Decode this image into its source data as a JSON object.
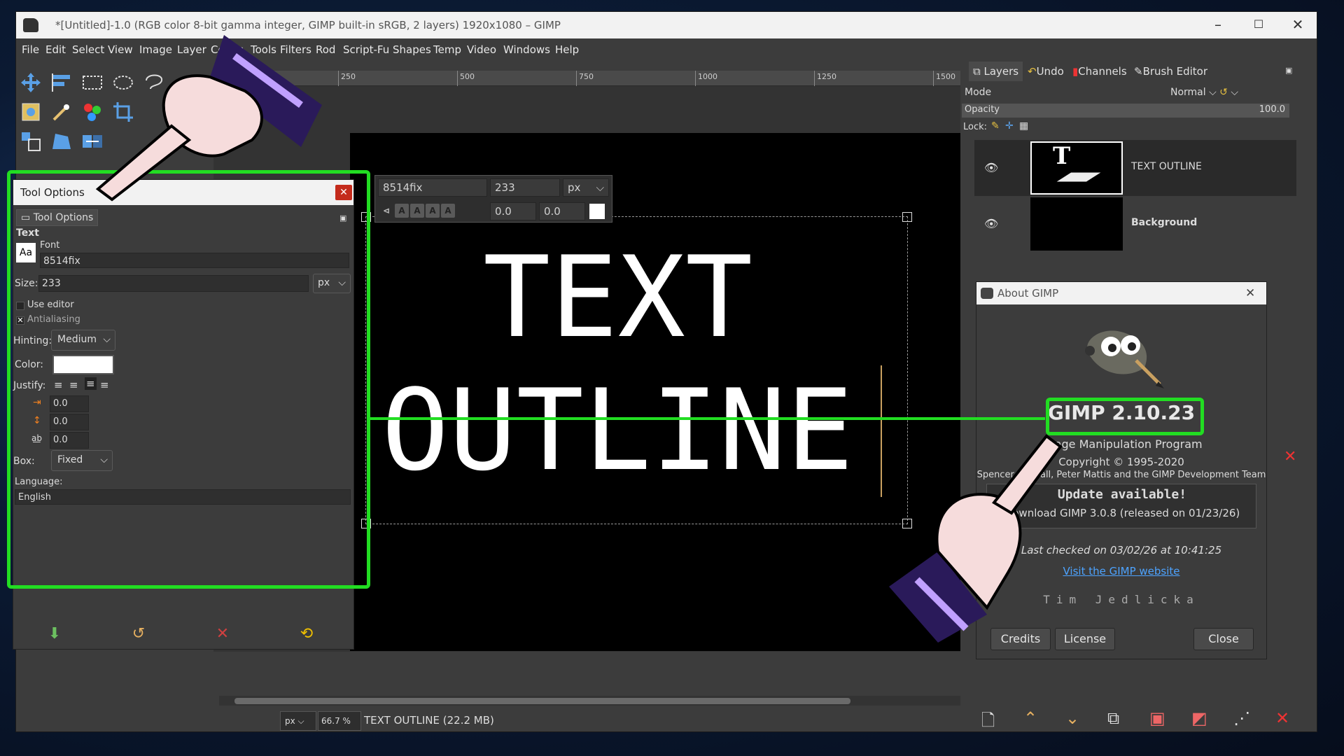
{
  "window": {
    "title": "*[Untitled]-1.0 (RGB color 8-bit gamma integer, GIMP built-in sRGB, 2 layers) 1920x1080 – GIMP",
    "minimize": "–",
    "maximize": "☐",
    "close": "✕"
  },
  "menu": [
    "File",
    "Edit",
    "Select",
    "View",
    "Image",
    "Layer",
    "Colors",
    "Tools",
    "Filters",
    "Rod",
    "Script-Fu",
    "Shapes",
    "Temp",
    "Video",
    "Windows",
    "Help"
  ],
  "ruler": [
    "250",
    "500",
    "750",
    "1000",
    "1250",
    "1500"
  ],
  "text_toolbar": {
    "font": "8514fix",
    "size": "233",
    "unit": "px",
    "baseline": "0.0",
    "kerning": "0.0"
  },
  "canvas": {
    "line1": "TEXT",
    "line2": "OUTLINE"
  },
  "status": {
    "unit": "px",
    "zoom": "66.7 %",
    "info": "TEXT OUTLINE (22.2 MB)"
  },
  "tool_options": {
    "window_title": "Tool Options",
    "tab_label": "Tool Options",
    "section": "Text",
    "font_label": "Font",
    "font_value": "8514fix",
    "font_preview": "Aa",
    "size_label": "Size:",
    "size_value": "233",
    "size_unit": "px",
    "use_editor": "Use editor",
    "antialiasing": "Antialiasing",
    "hinting_label": "Hinting:",
    "hinting_value": "Medium",
    "color_label": "Color:",
    "justify_label": "Justify:",
    "indent": "0.0",
    "line_spacing": "0.0",
    "letter_spacing": "0.0",
    "box_label": "Box:",
    "box_value": "Fixed",
    "language_label": "Language:",
    "language_value": "English"
  },
  "dock": {
    "tabs": [
      "Layers",
      "Undo",
      "Channels",
      "Brush Editor"
    ],
    "mode_label": "Mode",
    "mode_value": "Normal",
    "opacity_label": "Opacity",
    "opacity_value": "100.0",
    "lock_label": "Lock:",
    "layers": [
      {
        "name": "TEXT OUTLINE"
      },
      {
        "name": "Background"
      }
    ]
  },
  "about": {
    "title": "About GIMP",
    "version": "GIMP 2.10.23",
    "subtitle": "Image Manipulation Program",
    "copyright": "Copyright © 1995-2020",
    "authors": "Spencer Kimball, Peter Mattis and the GIMP Development Team",
    "update_heading": "Update available!",
    "update_text": "Download GIMP 3.0.8 (released on 01/23/26)",
    "checked_text": "Last checked on 03/02/26 at 10:41:25",
    "link": "Visit the GIMP website",
    "author_name": "Tim Jedlicka",
    "buttons": [
      "Credits",
      "License",
      "Close"
    ]
  },
  "colors": {
    "highlight": "#22dd22",
    "link": "#4da3ff"
  }
}
